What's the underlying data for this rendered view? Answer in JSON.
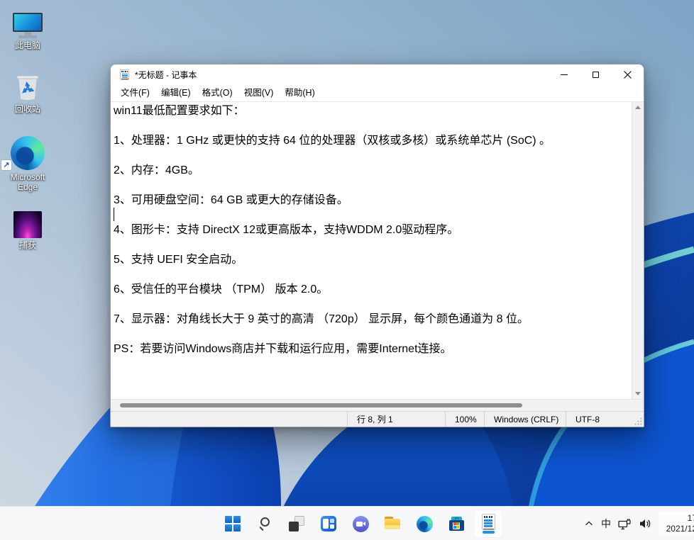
{
  "desktop": {
    "icons": [
      {
        "label": "此电脑"
      },
      {
        "label": "回收站"
      },
      {
        "label": "Microsoft Edge"
      },
      {
        "label": "捕获"
      }
    ]
  },
  "window": {
    "title": "*无标题 - 记事本",
    "menu": [
      "文件(F)",
      "编辑(E)",
      "格式(O)",
      "视图(V)",
      "帮助(H)"
    ],
    "editor": {
      "text": "win11最低配置要求如下：\n\n1、处理器：1 GHz 或更快的支持 64 位的处理器（双核或多核）或系统单芯片 (SoC) 。\n\n2、内存：4GB。\n\n3、可用硬盘空间：64 GB 或更大的存储设备。\n\n4、图形卡：支持 DirectX 12或更高版本，支持WDDM 2.0驱动程序。\n\n5、支持 UEFI 安全启动。\n\n6、受信任的平台模块 （TPM） 版本 2.0。\n\n7、显示器：对角线长大于 9 英寸的高清 （720p） 显示屏，每个颜色通道为 8 位。\n\nPS：若要访问Windows商店并下载和运行应用，需要Internet连接。"
    },
    "statusbar": {
      "cursor_position": "行 8, 列 1",
      "zoom_level": "100%",
      "line_ending": "Windows (CRLF)",
      "encoding": "UTF-8"
    }
  },
  "taskbar": {
    "tray": {
      "ime_indicator": "中",
      "clock_time": "17",
      "clock_date": "2021/12"
    }
  },
  "colors": {
    "accent_blue": "#0d66c4",
    "wallpaper_sky": "#9db9d2",
    "wallpaper_bloom": "#0a47c4",
    "taskbar_bg": "#f6f7f9"
  }
}
